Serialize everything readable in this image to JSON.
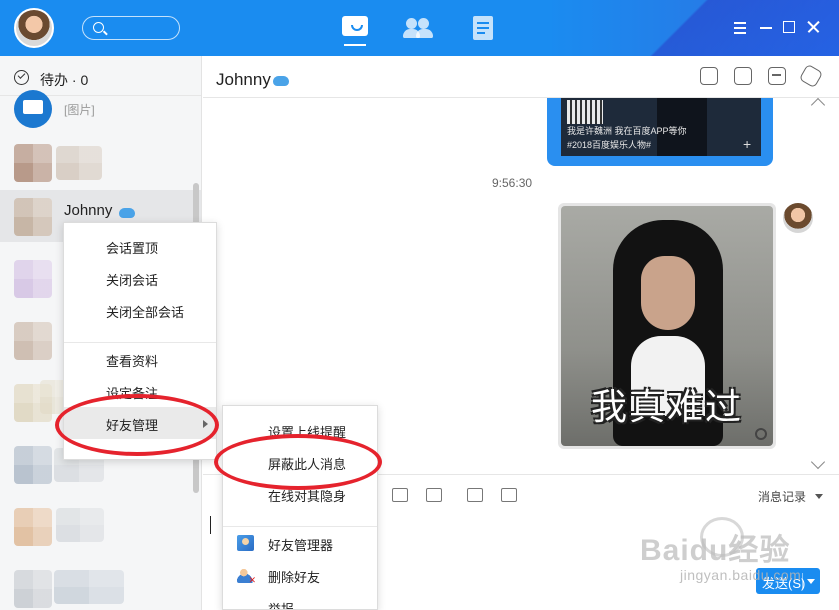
{
  "titlebar": {
    "nav": [
      "messages",
      "contacts",
      "documents"
    ],
    "icons": [
      "user-avatar",
      "search-icon",
      "message-icon",
      "contacts-icon",
      "docs-icon",
      "menu-icon",
      "minimize-icon",
      "maximize-icon",
      "close-icon"
    ]
  },
  "sidebar": {
    "todo_label": "待办 · 0",
    "contacts": [
      {
        "name": "",
        "preview": "[图片]"
      },
      {
        "name": "",
        "preview": ""
      },
      {
        "name": "Johnny",
        "preview": "",
        "active": true
      },
      {
        "name": "",
        "preview": ""
      },
      {
        "name": "",
        "preview": ""
      },
      {
        "name": "",
        "preview": ""
      },
      {
        "name": "",
        "preview": ""
      },
      {
        "name": "",
        "preview": ""
      }
    ]
  },
  "chat": {
    "title": "Johnny",
    "card_text_line1": "我是许魏洲 我在百度APP等你",
    "card_text_line2": "#2018百度娱乐人物#",
    "timestamp": "9:56:30",
    "meme_caption": "我真难过",
    "history_label": "消息记录",
    "send_label": "发送(S)"
  },
  "context_menu": {
    "items": [
      "会话置顶",
      "关闭会话",
      "关闭全部会话",
      "查看资料",
      "设定备注",
      "好友管理"
    ]
  },
  "friend_submenu": {
    "items": [
      "设置上线提醒",
      "屏蔽此人消息",
      "在线对其隐身",
      "好友管理器",
      "删除好友",
      "举报"
    ]
  },
  "watermark": {
    "brand": "Baidu经验",
    "url": "jingyan.baidu.com"
  },
  "colors": {
    "titlebar": "#1a8cf0",
    "highlight_ring": "#e5232d",
    "send_button": "#1a8cf0"
  }
}
